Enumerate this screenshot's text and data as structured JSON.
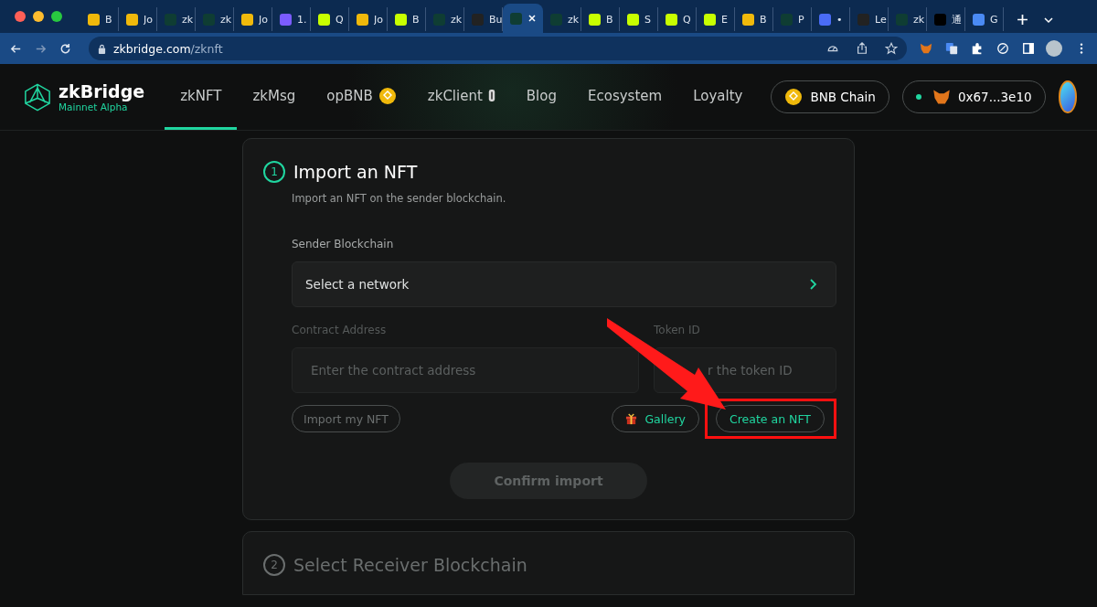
{
  "browser": {
    "tabs": [
      {
        "title": "B",
        "color": "#f0b90b",
        "selected": false
      },
      {
        "title": "Jo",
        "color": "#f0b90b",
        "selected": false
      },
      {
        "title": "zk",
        "color": "#0f3d33",
        "selected": false
      },
      {
        "title": "zk",
        "color": "#0f3d33",
        "selected": false
      },
      {
        "title": "Jo",
        "color": "#f0b90b",
        "selected": false
      },
      {
        "title": "1.",
        "color": "#7b5cff",
        "selected": false
      },
      {
        "title": "Q",
        "color": "#c8ff00",
        "selected": false
      },
      {
        "title": "Jo",
        "color": "#f0b90b",
        "selected": false
      },
      {
        "title": "B",
        "color": "#c8ff00",
        "selected": false
      },
      {
        "title": "zk",
        "color": "#0f3d33",
        "selected": false
      },
      {
        "title": "Bu",
        "color": "#222222",
        "selected": false
      },
      {
        "color": "#0f3d33",
        "selected": true
      },
      {
        "title": "zk",
        "color": "#0f3d33",
        "selected": false
      },
      {
        "title": "B",
        "color": "#c8ff00",
        "selected": false
      },
      {
        "title": "S",
        "color": "#c8ff00",
        "selected": false
      },
      {
        "title": "Q",
        "color": "#c8ff00",
        "selected": false
      },
      {
        "title": "E",
        "color": "#c8ff00",
        "selected": false
      },
      {
        "title": "B",
        "color": "#f0b90b",
        "selected": false
      },
      {
        "title": "P",
        "color": "#0f3d33",
        "selected": false
      },
      {
        "title": "•",
        "color": "#4a6cf7",
        "selected": false
      },
      {
        "title": "Le",
        "color": "#222222",
        "selected": false
      },
      {
        "title": "zk",
        "color": "#0f3d33",
        "selected": false
      },
      {
        "title": "通",
        "color": "#000000",
        "selected": false
      },
      {
        "title": "G",
        "color": "#4a8af4",
        "selected": false
      }
    ],
    "url_host": "zkbridge.com",
    "url_path": "/zknft"
  },
  "nav": {
    "brand": "zkBridge",
    "subtitle": "Mainnet Alpha",
    "links": [
      {
        "label": "zkNFT",
        "selected": true,
        "kind": "plain"
      },
      {
        "label": "zkMsg",
        "selected": false,
        "kind": "plain"
      },
      {
        "label": "opBNB",
        "selected": false,
        "kind": "coin"
      },
      {
        "label": "zkClient",
        "selected": false,
        "kind": "chip"
      },
      {
        "label": "Blog",
        "selected": false,
        "kind": "plain"
      },
      {
        "label": "Ecosystem",
        "selected": false,
        "kind": "plain"
      },
      {
        "label": "Loyalty",
        "selected": false,
        "kind": "plain"
      }
    ],
    "chain_button": "BNB Chain",
    "wallet": "0x67...3e10"
  },
  "step1": {
    "number": "1",
    "title": "Import an NFT",
    "description": "Import an NFT on the sender blockchain.",
    "sender_label": "Sender Blockchain",
    "network_placeholder": "Select a network",
    "contract_label": "Contract Address",
    "contract_placeholder": "Enter the contract address",
    "token_label": "Token ID",
    "token_placeholder": "r the token ID",
    "import_button": "Import my NFT",
    "gallery_button": "Gallery",
    "create_button": "Create an NFT",
    "confirm_button": "Confirm import",
    "confirm_disabled": true
  },
  "step2": {
    "number": "2",
    "title": "Select Receiver Blockchain",
    "disabled": true
  }
}
